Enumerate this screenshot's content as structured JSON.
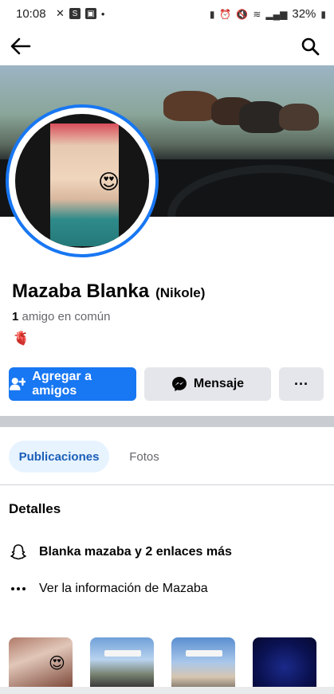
{
  "status_bar": {
    "time": "10:08",
    "battery": "32%",
    "s_badge": "S"
  },
  "profile": {
    "name": "Mazaba Blanka",
    "alternate_name": "(Nikole)",
    "mutual_count": "1",
    "mutual_text": "amigo en común",
    "bio_emoji": "🫀",
    "avatar_emoji": "😍"
  },
  "actions": {
    "add_friend_label": "Agregar a amigos",
    "message_label": "Mensaje",
    "more_label": "···"
  },
  "tabs": [
    {
      "label": "Publicaciones",
      "active": true
    },
    {
      "label": "Fotos",
      "active": false
    }
  ],
  "details": {
    "title": "Detalles",
    "snapchat_text": "Blanka mazaba y 2 enlaces más",
    "more_info_text": "Ver la información de Mazaba"
  },
  "thumbnails": {
    "thumb1_emoji": "😍"
  },
  "colors": {
    "accent": "#1877f2",
    "secondary_button": "#e4e6eb",
    "active_tab_bg": "#e7f3ff"
  }
}
